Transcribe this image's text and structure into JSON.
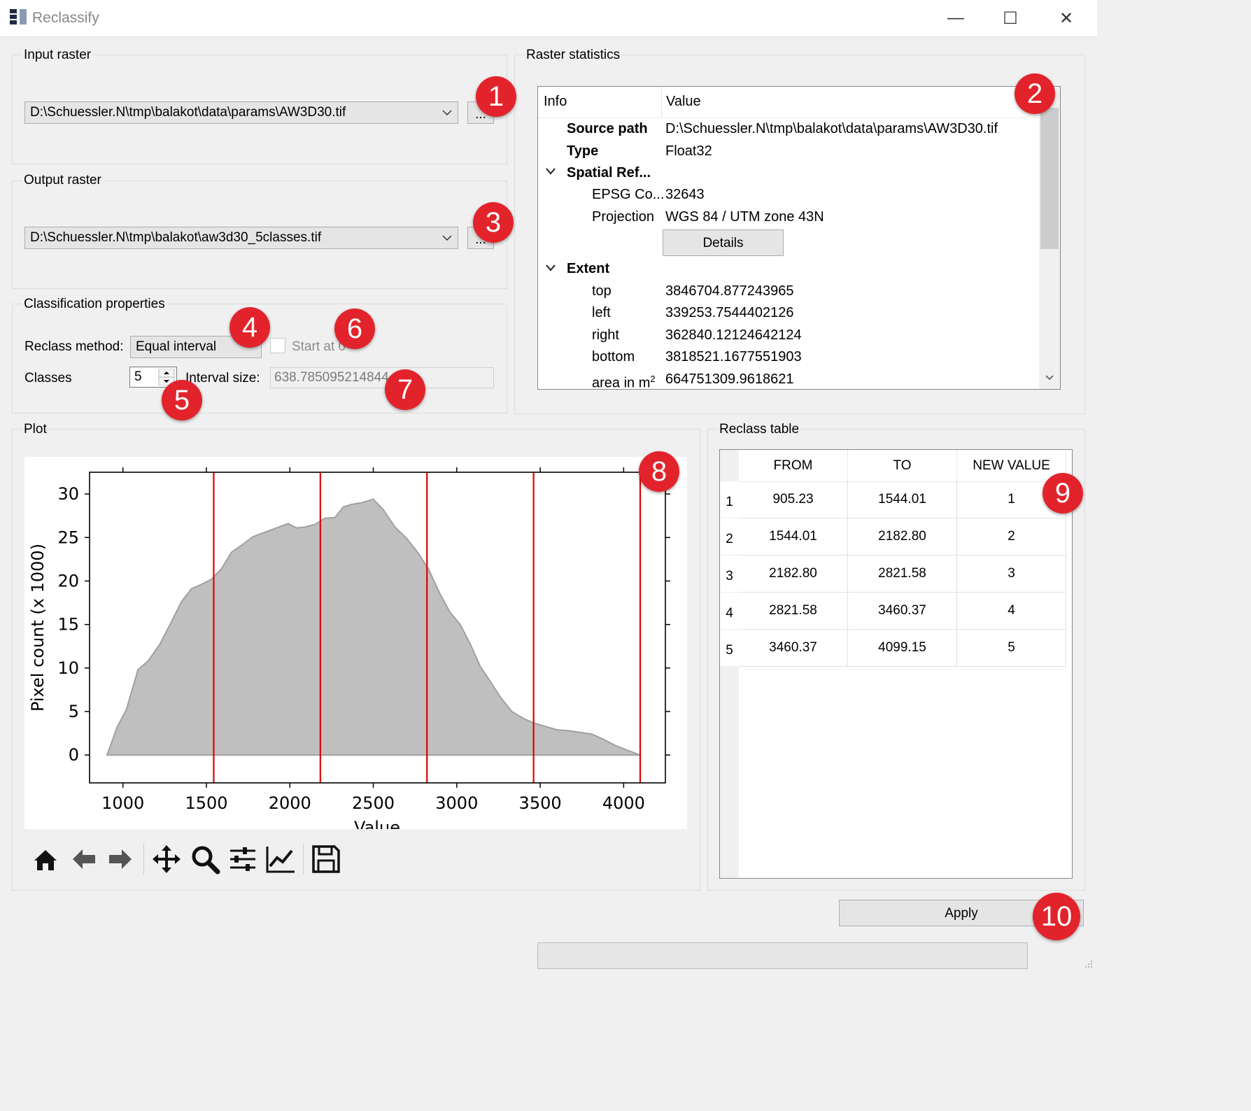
{
  "window": {
    "title": "Reclassify",
    "minimize": "—",
    "maximize": "☐",
    "close": "✕"
  },
  "input_raster": {
    "group_label": "Input raster",
    "path": "D:\\Schuessler.N\\tmp\\balakot\\data\\params\\AW3D30.tif",
    "browse_label": "..."
  },
  "output_raster": {
    "group_label": "Output raster",
    "path": "D:\\Schuessler.N\\tmp\\balakot\\aw3d30_5classes.tif",
    "browse_label": "..."
  },
  "classification": {
    "group_label": "Classification properties",
    "method_label": "Reclass method:",
    "method_value": "Equal interval",
    "start_at_zero_label": "Start at 0",
    "start_at_zero_checked": false,
    "classes_label": "Classes",
    "classes_value": "5",
    "interval_label": "Interval size:",
    "interval_value": "638.785095214844"
  },
  "raster_statistics": {
    "group_label": "Raster statistics",
    "col_info": "Info",
    "col_value": "Value",
    "rows": [
      {
        "key": "Source path",
        "value": "D:\\Schuessler.N\\tmp\\balakot\\data\\params\\AW3D30.tif"
      },
      {
        "key": "Type",
        "value": "Float32"
      },
      {
        "key": "Spatial Ref...",
        "value": ""
      },
      {
        "key": "EPSG Co...",
        "value": "32643"
      },
      {
        "key": "Projection",
        "value": "WGS 84 / UTM zone 43N"
      },
      {
        "key": "",
        "value": "Details"
      },
      {
        "key": "Extent",
        "value": ""
      },
      {
        "key": "top",
        "value": "3846704.877243965"
      },
      {
        "key": "left",
        "value": "339253.7544402126"
      },
      {
        "key": "right",
        "value": "362840.12124642124"
      },
      {
        "key": "bottom",
        "value": "3818521.1677551903"
      },
      {
        "key": "area in m",
        "value": "664751309.9618621"
      }
    ],
    "area_superscript": "2"
  },
  "plot": {
    "group_label": "Plot",
    "toolbar": [
      "home-icon",
      "back-icon",
      "forward-icon",
      "pan-icon",
      "zoom-icon",
      "configure-icon",
      "edit-axis-icon",
      "save-icon"
    ]
  },
  "chart_data": {
    "type": "area",
    "xlabel": "Value",
    "ylabel": "Pixel count (x 1000)",
    "xlim": [
      800,
      4250
    ],
    "ylim": [
      -3.2,
      32.5
    ],
    "xticks": [
      1000,
      1500,
      2000,
      2500,
      3000,
      3500,
      4000
    ],
    "yticks": [
      0,
      5,
      10,
      15,
      20,
      25,
      30
    ],
    "x": [
      905,
      965,
      1020,
      1090,
      1150,
      1220,
      1290,
      1350,
      1410,
      1470,
      1530,
      1590,
      1650,
      1710,
      1780,
      1850,
      1920,
      1990,
      2040,
      2090,
      2150,
      2210,
      2270,
      2320,
      2370,
      2430,
      2500,
      2560,
      2630,
      2700,
      2770,
      2830,
      2900,
      2960,
      3020,
      3080,
      3140,
      3200,
      3260,
      3330,
      3400,
      3460,
      3530,
      3600,
      3670,
      3740,
      3810,
      3880,
      3950,
      4030,
      4099
    ],
    "series": [
      {
        "values": [
          0,
          3.2,
          5.2,
          9.8,
          10.8,
          12.7,
          15.3,
          17.6,
          19.1,
          19.6,
          20.2,
          21.4,
          23.3,
          24.1,
          25.1,
          25.6,
          26.1,
          26.6,
          26.1,
          26.2,
          26.5,
          27.2,
          27.3,
          28.5,
          28.8,
          29.0,
          29.4,
          28.2,
          26.2,
          24.9,
          23.2,
          21.4,
          18.5,
          16.4,
          15.0,
          12.8,
          10.2,
          8.5,
          6.7,
          5.0,
          4.2,
          3.7,
          3.3,
          2.9,
          2.8,
          2.6,
          2.4,
          1.8,
          1.1,
          0.5,
          0
        ]
      }
    ],
    "breaks": [
      1544.01,
      2182.8,
      2821.58,
      3460.37,
      4099.15
    ],
    "fill_color": "#bfbfbf",
    "line_color": "#a0a0a0",
    "break_color": "#e00000"
  },
  "reclass_table": {
    "group_label": "Reclass table",
    "headers": [
      "FROM",
      "TO",
      "NEW VALUE"
    ],
    "rows": [
      {
        "index": "1",
        "from": "905.23",
        "to": "1544.01",
        "new": "1"
      },
      {
        "index": "2",
        "from": "1544.01",
        "to": "2182.80",
        "new": "2"
      },
      {
        "index": "3",
        "from": "2182.80",
        "to": "2821.58",
        "new": "3"
      },
      {
        "index": "4",
        "from": "2821.58",
        "to": "3460.37",
        "new": "4"
      },
      {
        "index": "5",
        "from": "3460.37",
        "to": "4099.15",
        "new": "5"
      }
    ]
  },
  "apply_label": "Apply",
  "badges": [
    "1",
    "2",
    "3",
    "4",
    "5",
    "6",
    "7",
    "8",
    "9",
    "10"
  ]
}
